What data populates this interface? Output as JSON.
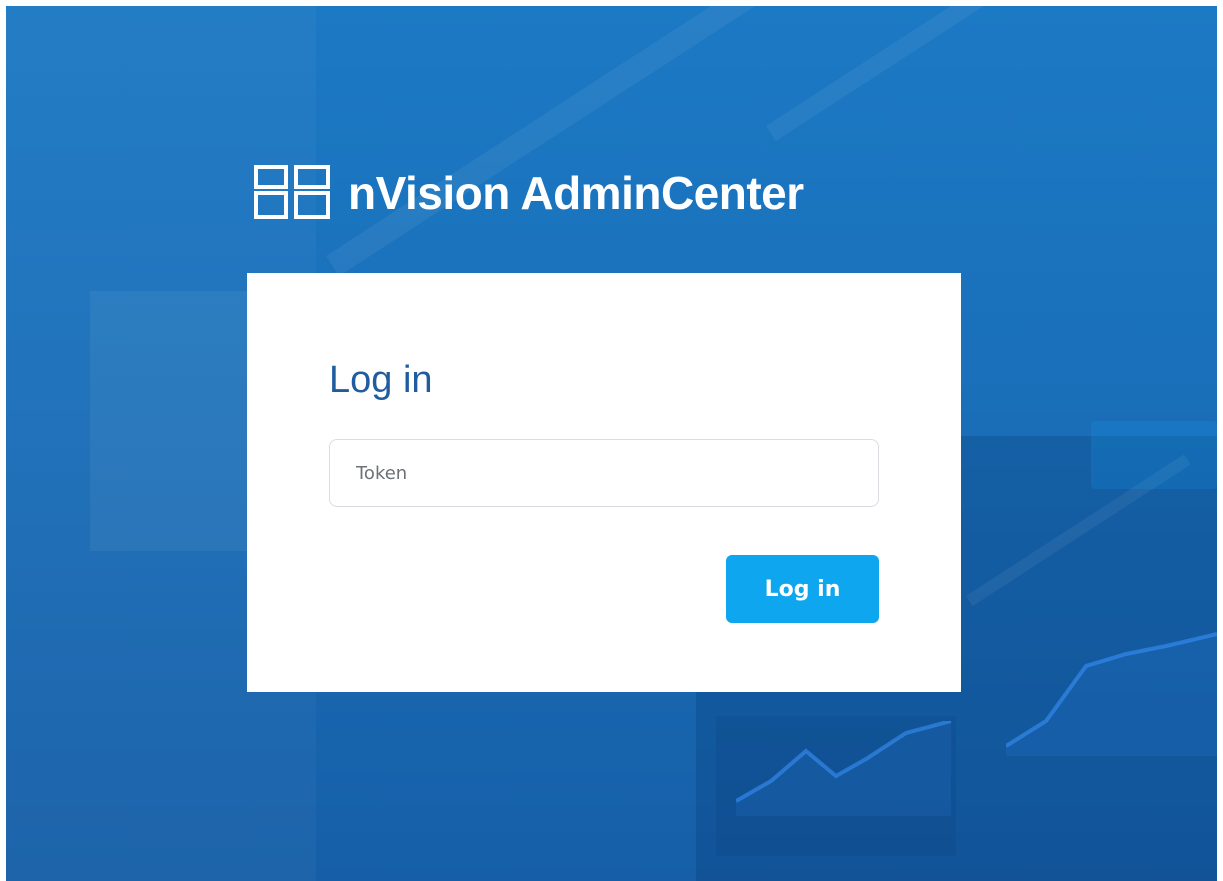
{
  "app": {
    "title": "nVision AdminCenter",
    "brand_icon": "dashboard-layout-icon",
    "colors": {
      "background": "#1a6fb9",
      "card": "#ffffff",
      "title": "#1f5d9f",
      "button": "#0ea6ef",
      "text": "#ffffff"
    }
  },
  "login": {
    "heading": "Log in",
    "token_placeholder": "Token",
    "token_value": "",
    "submit_label": "Log in"
  }
}
